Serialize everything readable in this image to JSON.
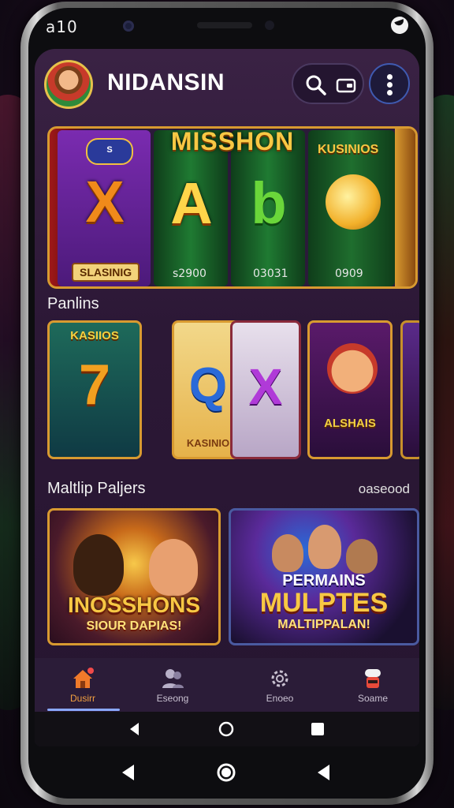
{
  "status_bar": {
    "time": "a10"
  },
  "header": {
    "title": "NIDANSIN"
  },
  "hero": {
    "title": "MISSHON",
    "badge": "S",
    "tag": "KUSINIOS",
    "symbols": [
      "X",
      "A",
      "b"
    ],
    "plate": "SLASINIG",
    "amounts": [
      "s2900",
      "03031",
      "0909"
    ]
  },
  "section_1": {
    "title": "Panlins"
  },
  "cards": [
    {
      "label": "KASIIOS",
      "symbol": "7"
    },
    {
      "label": "KASINIO",
      "symbol": "Q"
    },
    {
      "label": "",
      "symbol": "X"
    },
    {
      "label": "ALSHAIS",
      "symbol": ""
    }
  ],
  "section_2": {
    "title": "Maltlip Paljers",
    "link": "oaseood"
  },
  "multiplayer": [
    {
      "title": "INOSSHONS",
      "subtitle": "SIOUR DAPIAS!"
    },
    {
      "top": "PERMAINS",
      "title": "MULPTES",
      "subtitle": "MALTIPPALAN!"
    }
  ],
  "bottom_nav": [
    {
      "label": "Dusirr",
      "icon": "home-icon",
      "active": true
    },
    {
      "label": "Eseong",
      "icon": "people-icon",
      "active": false
    },
    {
      "label": "Enoeo",
      "icon": "gear-icon",
      "active": false
    },
    {
      "label": "Soame",
      "icon": "chef-icon",
      "active": false
    }
  ],
  "colors": {
    "accent_gold": "#d89a30",
    "active_nav": "#f2a040",
    "background": "#2c1836"
  }
}
